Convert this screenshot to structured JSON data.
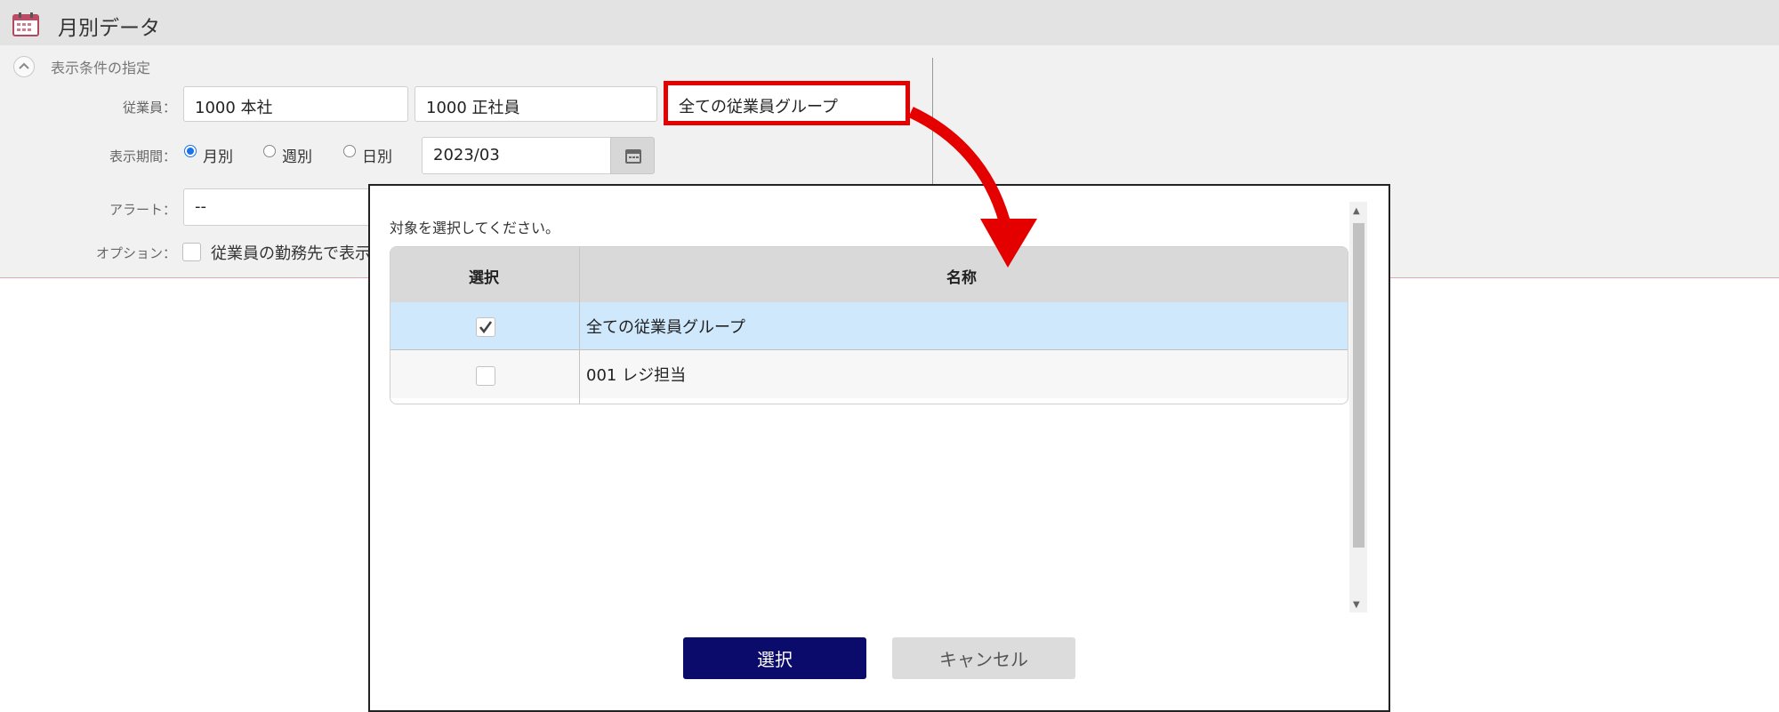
{
  "header": {
    "title": "月別データ",
    "icon": "calendar-icon"
  },
  "filter": {
    "section_label": "表示条件の指定",
    "employee_label": "従業員：",
    "employee_company": "1000 本社",
    "employee_type": "1000 正社員",
    "employee_group": "全ての従業員グループ",
    "period_label": "表示期間：",
    "period_options": [
      "月別",
      "週別",
      "日別"
    ],
    "period_selected": "月別",
    "date_value": "2023/03",
    "alert_label": "アラート：",
    "alert_value": "--",
    "option_label": "オプション：",
    "option_text": "従業員の勤務先で表示"
  },
  "dialog": {
    "prompt": "対象を選択してください。",
    "columns": [
      "選択",
      "名称"
    ],
    "rows": [
      {
        "name": "全ての従業員グループ",
        "checked": true
      },
      {
        "name": "001 レジ担当",
        "checked": false
      }
    ],
    "select_button": "選択",
    "cancel_button": "キャンセル"
  },
  "colors": {
    "primary_button": "#0b0b6b",
    "selected_row": "#cfe8fc",
    "highlight": "#e50000"
  }
}
